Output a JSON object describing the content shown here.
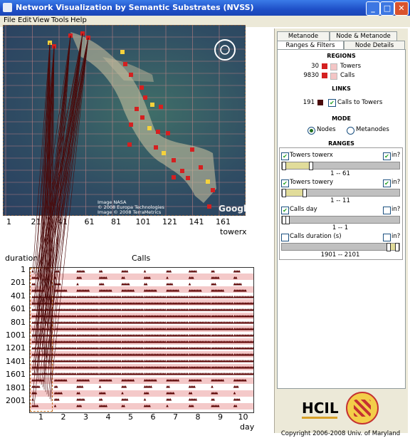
{
  "window": {
    "title": "Network Visualization by Semantic Substrates (NVSS)"
  },
  "menu": [
    "File",
    "Edit",
    "View",
    "Tools",
    "Help"
  ],
  "tabs": {
    "row1": [
      "Metanode Details",
      "Node & Metanode Size"
    ],
    "row2": [
      "Ranges & Filters",
      "Node Details"
    ],
    "selected": "Ranges & Filters"
  },
  "regions": {
    "header": "REGIONS",
    "items": [
      {
        "count": "30",
        "label": "Towers",
        "color": "#d42020"
      },
      {
        "count": "9830",
        "label": "Calls",
        "color": "#d42020"
      }
    ]
  },
  "links": {
    "header": "LINKS",
    "count": "191",
    "label": "Calls to Towers",
    "checked": true,
    "color": "#4a0a0a"
  },
  "mode": {
    "header": "MODE",
    "options": [
      "Nodes",
      "Metanodes"
    ],
    "selected": "Nodes"
  },
  "ranges": {
    "header": "RANGES",
    "items": [
      {
        "label": "Towers  towerx",
        "checked": true,
        "in_label": "in?",
        "in_checked": true,
        "range": "1  --  61",
        "fill_from": 0.0,
        "fill_to": 0.24
      },
      {
        "label": "Towers  towery",
        "checked": true,
        "in_label": "in?",
        "in_checked": true,
        "range": "1  --  11",
        "fill_from": 0.0,
        "fill_to": 0.19
      },
      {
        "label": "Calls  day",
        "checked": true,
        "in_label": "in?",
        "in_checked": false,
        "range": "1  --  1",
        "fill_from": 0.0,
        "fill_to": 0.04
      },
      {
        "label": "Calls  duration (s)",
        "checked": false,
        "in_label": "in?",
        "in_checked": false,
        "range": "1901  --  2101",
        "fill_from": 0.9,
        "fill_to": 1.0
      }
    ]
  },
  "map": {
    "x_ticks": [
      "1",
      "21",
      "41",
      "61",
      "81",
      "101",
      "121",
      "141",
      "161"
    ],
    "x_label": "towerx",
    "watermark": [
      "Image NASA",
      "© 2008 Europa Technologies",
      "Image © 2008 TerraMetrics"
    ],
    "google": "Google",
    "tower_color": "#d42020"
  },
  "chart_data": {
    "type": "scatter",
    "title": "Calls",
    "xlabel": "day",
    "ylabel": "duration",
    "x_ticks": [
      "1",
      "2",
      "3",
      "4",
      "5",
      "6",
      "7",
      "8",
      "9",
      "10"
    ],
    "y_ticks": [
      "1",
      "201",
      "401",
      "601",
      "801",
      "1001",
      "1201",
      "1401",
      "1601",
      "1801",
      "2001"
    ],
    "xlim": [
      0.5,
      10.5
    ],
    "ylim": [
      2101,
      1
    ],
    "marker_color": "#5a0000"
  },
  "logos": {
    "hcil": "HCIL"
  },
  "copyright": "Copyright 2006-2008   Univ. of Maryland"
}
